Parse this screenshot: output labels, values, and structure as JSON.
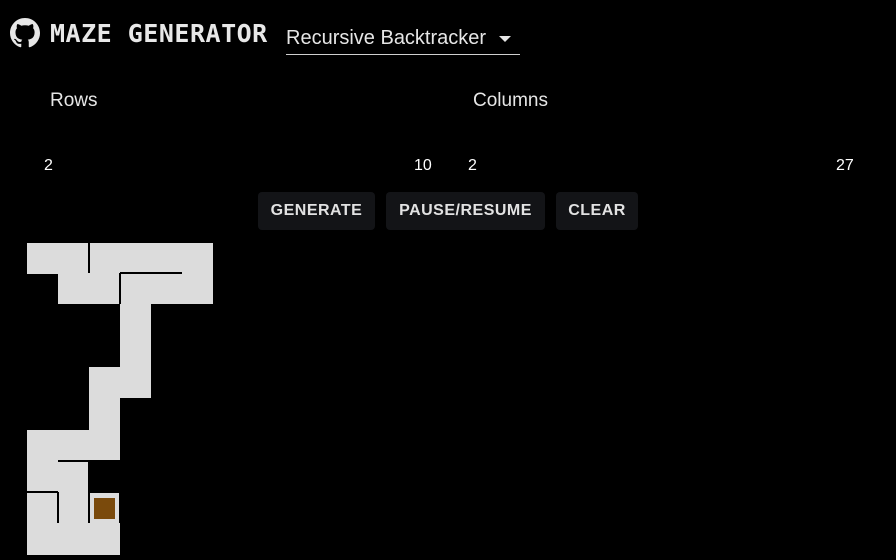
{
  "header": {
    "title": "MAZE GENERATOR",
    "logo_icon": "github-icon"
  },
  "algorithm_select": {
    "selected": "Recursive Backtracker",
    "icon": "caret-down-icon"
  },
  "sliders": {
    "rows": {
      "label": "Rows",
      "min": "2",
      "max": "10"
    },
    "columns": {
      "label": "Columns",
      "min": "2",
      "max": "27"
    }
  },
  "buttons": {
    "generate": "GENERATE",
    "pause_resume": "PAUSE/RESUME",
    "clear": "CLEAR"
  },
  "maze": {
    "cell_color": "#dcdcdc",
    "wall_color": "#000000",
    "marker_color": "#7a4a0c"
  }
}
